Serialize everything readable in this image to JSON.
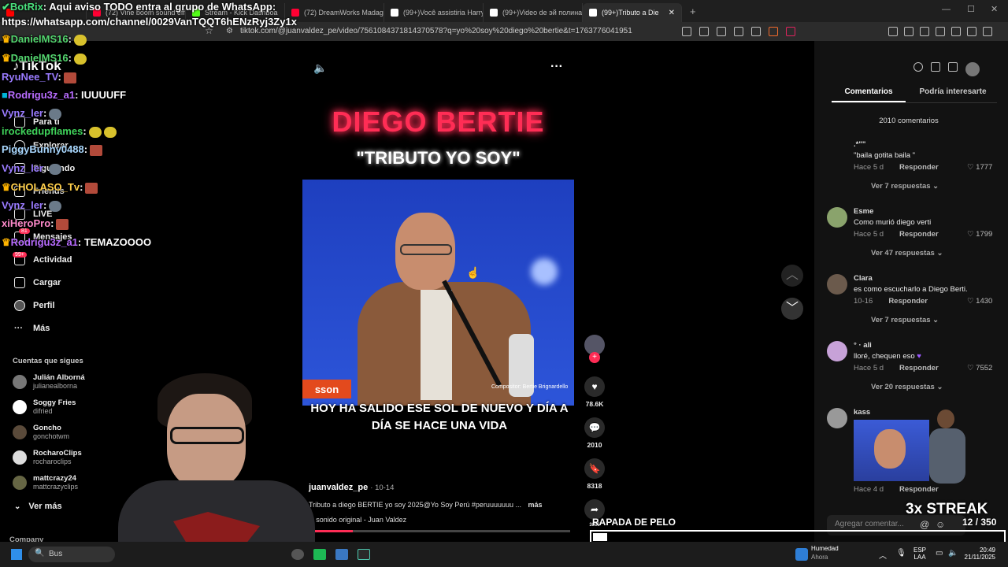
{
  "tabs": [
    {
      "title": "",
      "color": "#ff0000"
    },
    {
      "title": "(72) Vine boom sound effe",
      "color": "#ff0033"
    },
    {
      "title": "Stream - Kick Dashboa",
      "color": "#53fc18"
    },
    {
      "title": "(72) DreamWorks Madag",
      "color": "#ff0033"
    },
    {
      "title": "(99+)Você assistiria Harry",
      "color": "#ffffff"
    },
    {
      "title": "(99+)Video de эй полина",
      "color": "#ffffff"
    },
    {
      "title": "(99+)Tributo a Die",
      "color": "#ffffff"
    }
  ],
  "browser": {
    "url": "tiktok.com/@juanvaldez_pe/video/7561084371814370578?q=yo%20soy%20diego%20bertie&t=1763776041951"
  },
  "chat": {
    "banner_user": "BotRix",
    "banner_text": ": Aqui aviso TODO entra al grupo de WhatsApp:",
    "banner_link": "https://whatsapp.com/channel/0029VanTQQT6hENzRyj3Zy1x",
    "lines": [
      {
        "user": "DanielMS16",
        "msg": ":",
        "color": "#54d66f"
      },
      {
        "user": "DanielMS16",
        "msg": ":",
        "color": "#54d66f"
      },
      {
        "user": "RyuNee_TV",
        "msg": ":",
        "color": "#9a7bff"
      },
      {
        "user": "Rodrigu3z_a1",
        "msg": ": IUUUUFF",
        "color": "#b86cff"
      },
      {
        "user": "Vynz_ler",
        "msg": ":",
        "color": "#9a7bff"
      },
      {
        "user": "irockedupflames",
        "msg": ":",
        "color": "#3fd35a"
      },
      {
        "user": "PiggyBunny0488",
        "msg": ":",
        "color": "#a9d8ff"
      },
      {
        "user": "Vynz_ler",
        "msg": ":",
        "color": "#9a7bff"
      },
      {
        "user": "CHOLASO_Tv",
        "msg": ":",
        "color": "#ffcf4a"
      },
      {
        "user": "Vynz_ler",
        "msg": ":",
        "color": "#9a7bff"
      },
      {
        "user": "xiHeroPro",
        "msg": ":",
        "color": "#ff8acb"
      },
      {
        "user": "Rodrigu3z_a1",
        "msg": ": TEMAZOOOO",
        "color": "#b86cff"
      }
    ]
  },
  "nav": {
    "logo": "TikTok",
    "items": [
      "Para ti",
      "Explorar",
      "Siguiendo",
      "Friends",
      "LIVE",
      "Mensajes",
      "Actividad",
      "Cargar",
      "Perfil",
      "Más"
    ],
    "badges": {
      "mensajes": "81",
      "actividad": "99+"
    },
    "following_title": "Cuentas que sigues",
    "following": [
      {
        "name": "Julián Alborná",
        "handle": "julianealborna"
      },
      {
        "name": "Soggy Fries",
        "handle": "difried"
      },
      {
        "name": "Goncho",
        "handle": "gonchotwm"
      },
      {
        "name": "RocharoClips",
        "handle": "rocharoclips"
      },
      {
        "name": "mattcrazy24",
        "handle": "mattcrazyclips"
      }
    ],
    "more": "Ver más",
    "company": "Company"
  },
  "video": {
    "title": "DIEGO BERTIE",
    "subtitle": "\"TRIBUTO YO SOY\"",
    "caption": "HOY HA SALIDO ESE SOL DE NUEVO Y DÍA A DÍA SE HACE UNA VIDA",
    "logo": "sson",
    "composer": "Compositor: Bertie Brignardello",
    "author": "juanvaldez_pe",
    "date": "· 10-14",
    "description": "Tributo a diego BERTIE yo soy 2025@Yo Soy Perú #peruuuuuuu",
    "more": "más",
    "sound": "sonido original - Juan Valdez",
    "progress": 0.18
  },
  "actions": {
    "likes": "78.6K",
    "comments": "2010",
    "saves": "8318",
    "shares": "3865"
  },
  "comments_panel": {
    "tab_active": "Comentarios",
    "tab_other": "Podría interesarte",
    "count": "2010 comentarios",
    "reply_label": "Responder",
    "input_placeholder": "Agregar comentar...",
    "items": [
      {
        "name": ".*\"\"",
        "text": "\"baila gotita baila \"",
        "meta": "Hace 5 d",
        "likes": "1777",
        "replies": "Ver 7 respuestas"
      },
      {
        "name": "Esme",
        "text": "Como murió diego verti",
        "meta": "Hace 5 d",
        "likes": "1799",
        "replies": "Ver 47 respuestas"
      },
      {
        "name": "Clara",
        "text": "es como escucharlo a Diego Berti.",
        "meta": "10-16",
        "likes": "1430",
        "replies": "Ver 7 respuestas"
      },
      {
        "name": "° · ali",
        "text": "lloré, chequen eso",
        "meta": "Hace 5 d",
        "likes": "7552",
        "replies": "Ver 20 respuestas"
      },
      {
        "name": "kass",
        "text": "",
        "meta": "Hace 4 d",
        "likes": "",
        "replies": ""
      }
    ]
  },
  "overlay": {
    "streak": "3x STREAK",
    "counter": "12 / 350",
    "goal": "RAPADA DE PELO",
    "goal_progress": 0.034
  },
  "taskbar": {
    "search": "Bus",
    "weather": "Humedad",
    "weather_sub": "Ahora",
    "lang": "ESP",
    "lang_sub": "LAA",
    "time": "20:49",
    "date": "21/11/2025"
  }
}
